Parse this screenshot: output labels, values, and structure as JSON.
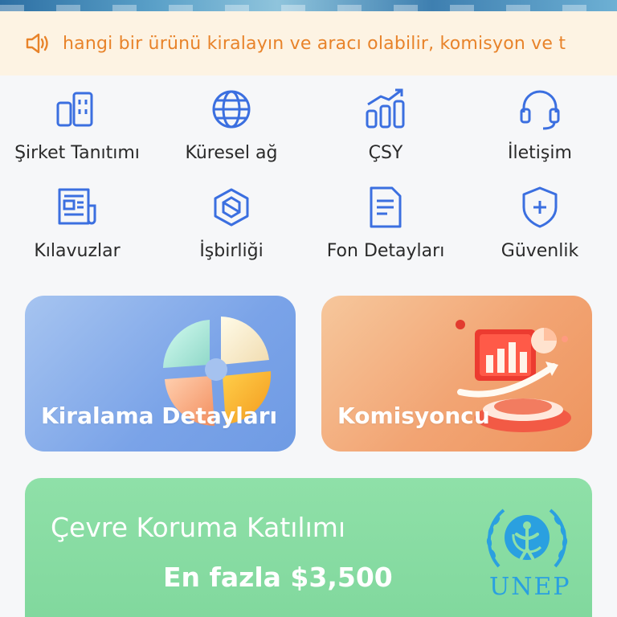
{
  "notice": {
    "icon": "speaker-icon",
    "text": "hangi bir ürünü kiralayın ve aracı olabilir, komisyon ve t"
  },
  "menu": [
    {
      "label": "Şirket Tanıtımı",
      "icon": "building-icon"
    },
    {
      "label": "Küresel ağ",
      "icon": "globe-icon"
    },
    {
      "label": "ÇSY",
      "icon": "chart-icon"
    },
    {
      "label": "İletişim",
      "icon": "headset-icon"
    },
    {
      "label": "Kılavuzlar",
      "icon": "newspaper-icon"
    },
    {
      "label": "İşbirliği",
      "icon": "cooperation-icon"
    },
    {
      "label": "Fon Detayları",
      "icon": "document-icon"
    },
    {
      "label": "Güvenlik",
      "icon": "shield-icon"
    }
  ],
  "cards": {
    "left": {
      "title": "Kiralama Detayları"
    },
    "right": {
      "title": "Komisyoncu"
    }
  },
  "promo": {
    "title": "Çevre Koruma Katılımı",
    "subtitle": "En fazla $3,500",
    "logo_text": "UNEP"
  },
  "colors": {
    "accent_blue": "#3b6fe0",
    "notice_text": "#e8832a",
    "notice_bg": "#fdf3e3",
    "promo_green": "#8fe0a8",
    "unep_blue": "#2aa0e0"
  }
}
